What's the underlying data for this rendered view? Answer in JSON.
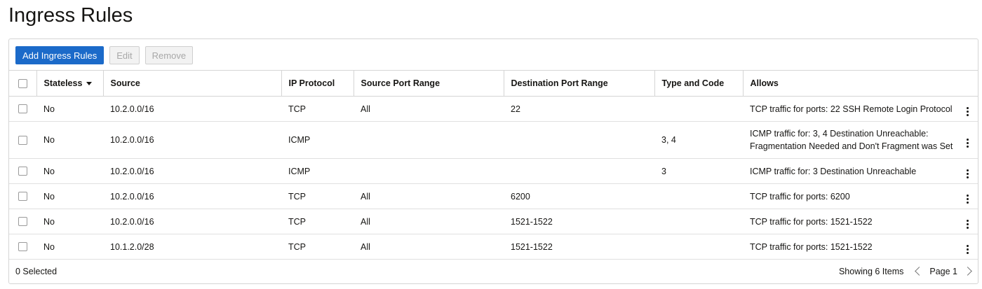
{
  "page": {
    "title": "Ingress Rules"
  },
  "toolbar": {
    "add_label": "Add Ingress Rules",
    "edit_label": "Edit",
    "remove_label": "Remove"
  },
  "table": {
    "headers": [
      "Stateless",
      "Source",
      "IP Protocol",
      "Source Port Range",
      "Destination Port Range",
      "Type and Code",
      "Allows"
    ],
    "sort_column": "Stateless",
    "rows": [
      {
        "stateless": "No",
        "source": "10.2.0.0/16",
        "protocol": "TCP",
        "src_port": "All",
        "dst_port": "22",
        "type_code": "",
        "allows": "TCP traffic for ports: 22 SSH Remote Login Protocol"
      },
      {
        "stateless": "No",
        "source": "10.2.0.0/16",
        "protocol": "ICMP",
        "src_port": "",
        "dst_port": "",
        "type_code": "3, 4",
        "allows": "ICMP traffic for: 3, 4 Destination Unreachable: Fragmentation Needed and Don't Fragment was Set"
      },
      {
        "stateless": "No",
        "source": "10.2.0.0/16",
        "protocol": "ICMP",
        "src_port": "",
        "dst_port": "",
        "type_code": "3",
        "allows": "ICMP traffic for: 3 Destination Unreachable"
      },
      {
        "stateless": "No",
        "source": "10.2.0.0/16",
        "protocol": "TCP",
        "src_port": "All",
        "dst_port": "6200",
        "type_code": "",
        "allows": "TCP traffic for ports: 6200"
      },
      {
        "stateless": "No",
        "source": "10.2.0.0/16",
        "protocol": "TCP",
        "src_port": "All",
        "dst_port": "1521-1522",
        "type_code": "",
        "allows": "TCP traffic for ports: 1521-1522"
      },
      {
        "stateless": "No",
        "source": "10.1.2.0/28",
        "protocol": "TCP",
        "src_port": "All",
        "dst_port": "1521-1522",
        "type_code": "",
        "allows": "TCP traffic for ports: 1521-1522"
      }
    ]
  },
  "footer": {
    "selected_text": "0 Selected",
    "showing_text": "Showing 6 Items",
    "page_text": "Page 1"
  },
  "colors": {
    "primary_button": "#1b6ac9",
    "border": "#d5d5d5"
  }
}
